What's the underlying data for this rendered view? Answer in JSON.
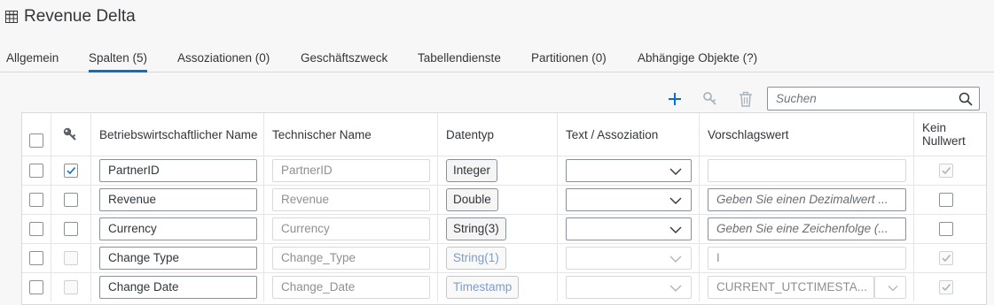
{
  "header": {
    "title": "Revenue Delta",
    "title_icon": "table-grid-icon"
  },
  "tabs": [
    {
      "label": "Allgemein",
      "active": false
    },
    {
      "label": "Spalten (5)",
      "active": true
    },
    {
      "label": "Assoziationen (0)",
      "active": false
    },
    {
      "label": "Geschäftszweck",
      "active": false
    },
    {
      "label": "Tabellendienste",
      "active": false
    },
    {
      "label": "Partitionen (0)",
      "active": false
    },
    {
      "label": "Abhängige Objekte (?)",
      "active": false
    }
  ],
  "toolbar": {
    "add_icon": "add-icon",
    "key_icon": "key-icon",
    "delete_icon": "delete-icon",
    "search_placeholder": "Suchen",
    "search_value": ""
  },
  "table": {
    "columns": {
      "key": "key-icon",
      "business_name": "Betriebswirtschaftlicher Name",
      "technical_name": "Technischer Name",
      "data_type": "Datentyp",
      "text_association": "Text / Assoziation",
      "default_value": "Vorschlagswert",
      "not_null": "Kein Nullwert"
    },
    "rows": [
      {
        "key_checked": true,
        "key_disabled": false,
        "business_name": "PartnerID",
        "technical_name": "PartnerID",
        "data_type": "Integer",
        "data_type_disabled": false,
        "text_association": "",
        "text_association_disabled": false,
        "default_value": "",
        "default_value_placeholder": "",
        "default_value_disabled": true,
        "not_null_checked": true,
        "not_null_disabled": true
      },
      {
        "key_checked": false,
        "key_disabled": false,
        "business_name": "Revenue",
        "technical_name": "Revenue",
        "data_type": "Double",
        "data_type_disabled": false,
        "text_association": "",
        "text_association_disabled": false,
        "default_value": "",
        "default_value_placeholder": "Geben Sie einen Dezimalwert ...",
        "default_value_disabled": false,
        "not_null_checked": false,
        "not_null_disabled": false
      },
      {
        "key_checked": false,
        "key_disabled": false,
        "business_name": "Currency",
        "technical_name": "Currency",
        "data_type": "String(3)",
        "data_type_disabled": false,
        "text_association": "",
        "text_association_disabled": false,
        "default_value": "",
        "default_value_placeholder": "Geben Sie eine Zeichenfolge (...",
        "default_value_disabled": false,
        "not_null_checked": false,
        "not_null_disabled": false
      },
      {
        "key_checked": false,
        "key_disabled": true,
        "business_name": "Change Type",
        "technical_name": "Change_Type",
        "data_type": "String(1)",
        "data_type_disabled": true,
        "text_association": "",
        "text_association_disabled": true,
        "default_value": "I",
        "default_value_placeholder": "",
        "default_value_disabled": true,
        "not_null_checked": true,
        "not_null_disabled": true
      },
      {
        "key_checked": false,
        "key_disabled": true,
        "business_name": "Change Date",
        "technical_name": "Change_Date",
        "data_type": "Timestamp",
        "data_type_disabled": true,
        "text_association": "",
        "text_association_disabled": true,
        "default_value": "CURRENT_UTCTIMESTA...",
        "default_value_placeholder": "",
        "default_value_disabled": true,
        "not_null_checked": true,
        "not_null_disabled": true
      }
    ]
  },
  "colors": {
    "accent": "#0a6ed1",
    "toolbar_icon": "#0a6ed1",
    "disabled_icon": "#a9b4be"
  }
}
